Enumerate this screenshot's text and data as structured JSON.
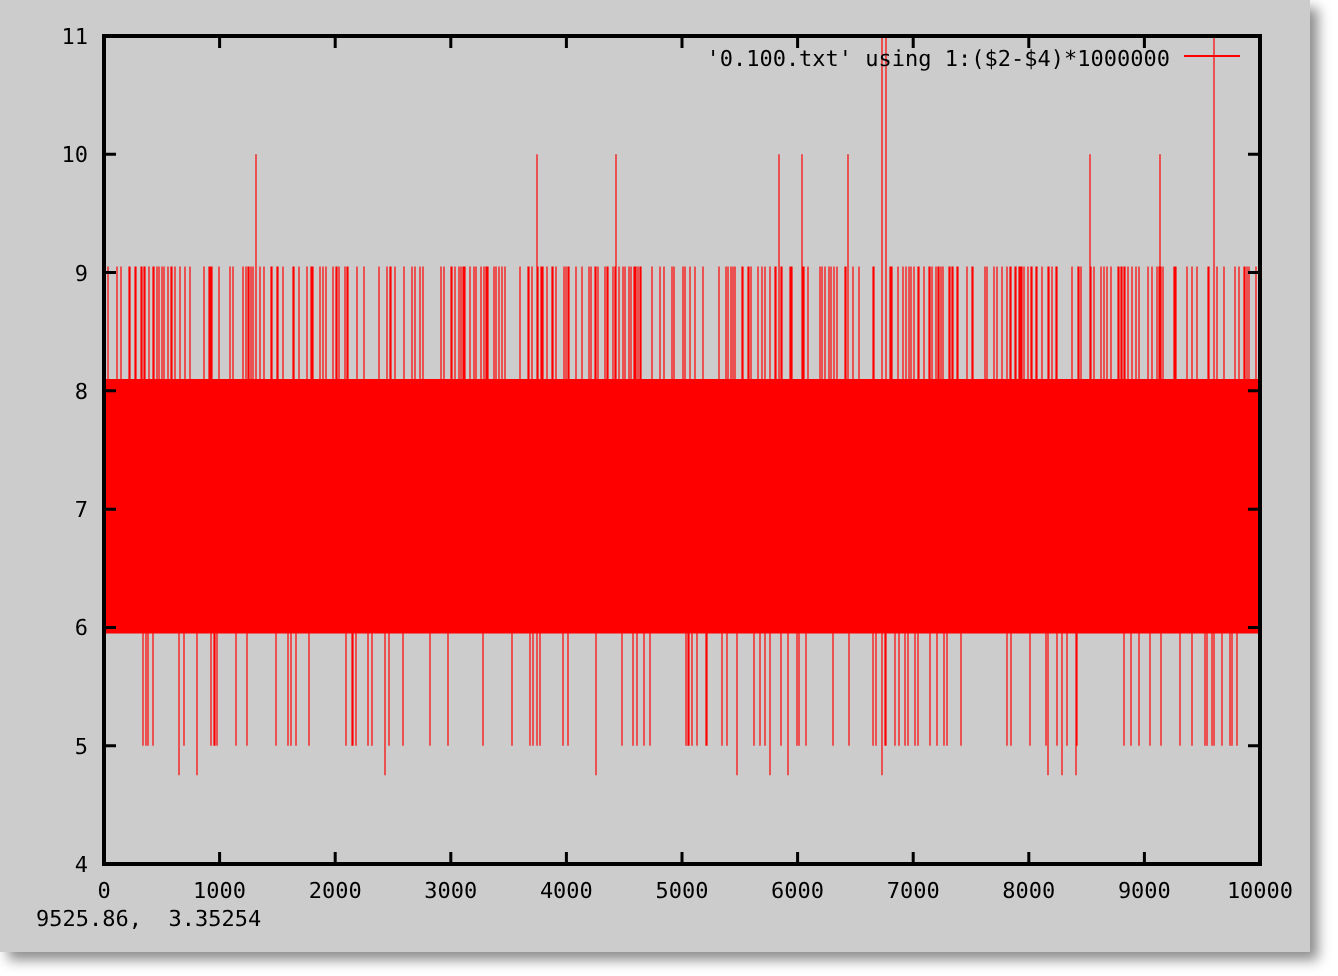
{
  "plot": {
    "legend": "'0.100.txt' using 1:($2-$4)*1000000",
    "yticks": [
      "11",
      "10",
      "9",
      "8",
      "7",
      "6",
      "5",
      "4"
    ],
    "xticks": [
      "0",
      "1000",
      "2000",
      "3000",
      "4000",
      "5000",
      "6000",
      "7000",
      "8000",
      "9000",
      "10000"
    ]
  },
  "status_bar": {
    "coordinates": "9525.86,  3.35254"
  }
}
